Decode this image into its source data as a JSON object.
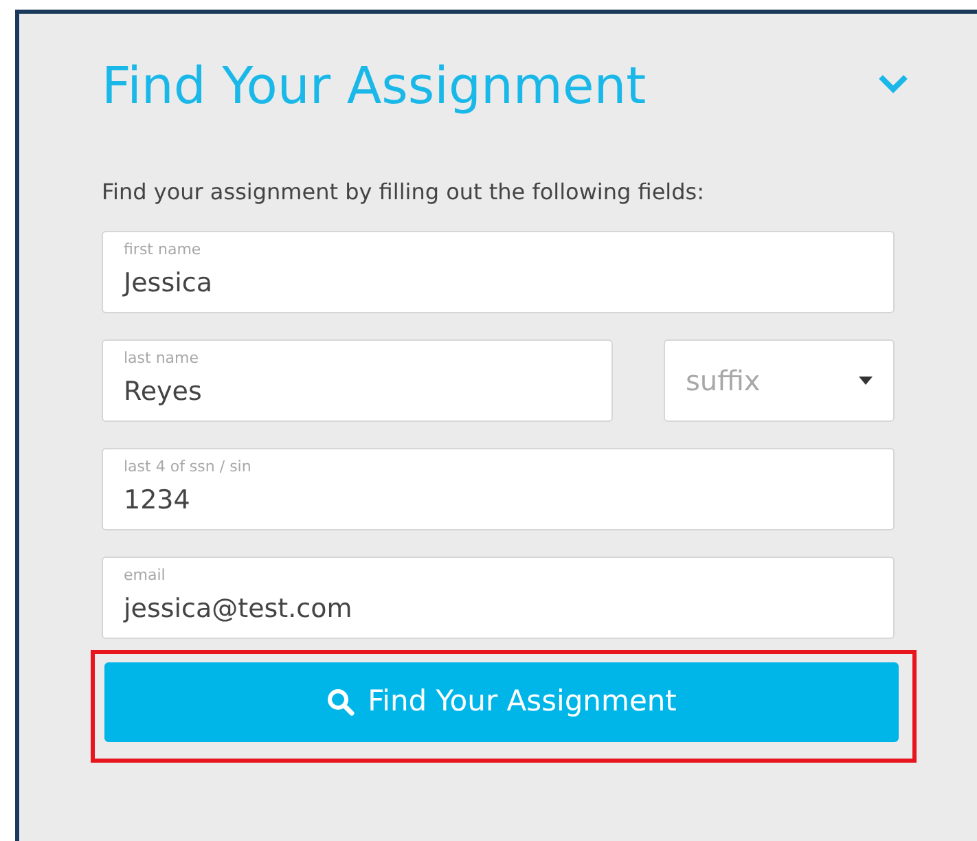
{
  "panel": {
    "title": "Find Your Assignment",
    "expanded": true
  },
  "instructions": "Find your assignment by filling out the following fields:",
  "fields": [
    {
      "kind": "text",
      "label": "first name",
      "value": "Jessica"
    },
    {
      "kind": "text",
      "label": "last name",
      "value": "Reyes"
    },
    {
      "kind": "select",
      "placeholder": "suffix"
    },
    {
      "kind": "text",
      "label": "last 4 of ssn / sin",
      "value": "1234"
    },
    {
      "kind": "text",
      "label": "email",
      "value": "jessica@test.com"
    }
  ],
  "submit": {
    "label": "Find Your Assignment",
    "highlighted": true
  }
}
